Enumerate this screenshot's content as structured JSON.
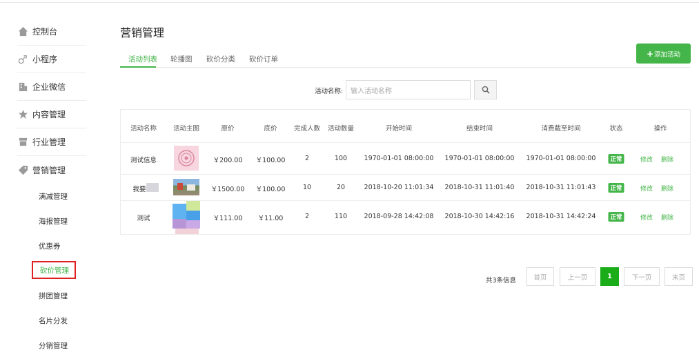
{
  "sidebar": {
    "items": [
      {
        "label": "控制台",
        "icon": "home-icon"
      },
      {
        "label": "小程序",
        "icon": "link-icon"
      },
      {
        "label": "企业微信",
        "icon": "building-icon"
      },
      {
        "label": "内容管理",
        "icon": "star-icon"
      },
      {
        "label": "行业管理",
        "icon": "store-icon"
      },
      {
        "label": "营销管理",
        "icon": "tag-icon"
      }
    ],
    "sub_items": [
      {
        "label": "满减管理"
      },
      {
        "label": "海报管理"
      },
      {
        "label": "优惠券"
      },
      {
        "label": "砍价管理"
      },
      {
        "label": "拼团管理"
      },
      {
        "label": "名片分发"
      },
      {
        "label": "分销管理"
      }
    ]
  },
  "main": {
    "title": "营销管理",
    "tabs": [
      {
        "label": "活动列表"
      },
      {
        "label": "轮播图"
      },
      {
        "label": "砍价分类"
      },
      {
        "label": "砍价订单"
      }
    ],
    "add_button": "添加活动",
    "search": {
      "label": "活动名称:",
      "placeholder": "输入活动名称"
    }
  },
  "table": {
    "headers": [
      "活动名称",
      "活动主图",
      "原价",
      "底价",
      "完成人数",
      "活动数量",
      "开始时间",
      "结束时间",
      "消费截至时间",
      "状态",
      "操作"
    ],
    "rows": [
      {
        "name": "测试信息",
        "price": "￥200.00",
        "floor": "￥100.00",
        "done": "2",
        "qty": "100",
        "start": "1970-01-01 08:00:00",
        "end": "1970-01-01 08:00:00",
        "consume": "1970-01-01 08:00:00",
        "status": "正常",
        "edit": "修改",
        "delete": "删除"
      },
      {
        "name": "我要",
        "price": "￥1500.00",
        "floor": "￥100.00",
        "done": "10",
        "qty": "20",
        "start": "2018-10-20 11:01:34",
        "end": "2018-10-31 11:01:40",
        "consume": "2018-10-31 11:01:43",
        "status": "正常",
        "edit": "修改",
        "delete": "删除"
      },
      {
        "name": "测试",
        "price": "￥111.00",
        "floor": "￥11.00",
        "done": "2",
        "qty": "110",
        "start": "2018-09-28 14:42:08",
        "end": "2018-10-30 14:42:16",
        "consume": "2018-10-31 14:42:24",
        "status": "正常",
        "edit": "修改",
        "delete": "删除"
      }
    ]
  },
  "pagination": {
    "info": "共3条信息",
    "first": "首页",
    "prev": "上一页",
    "current": "1",
    "next": "下一页",
    "last": "末页"
  },
  "colors": {
    "accent": "#44b549",
    "highlight_border": "#e02020"
  }
}
